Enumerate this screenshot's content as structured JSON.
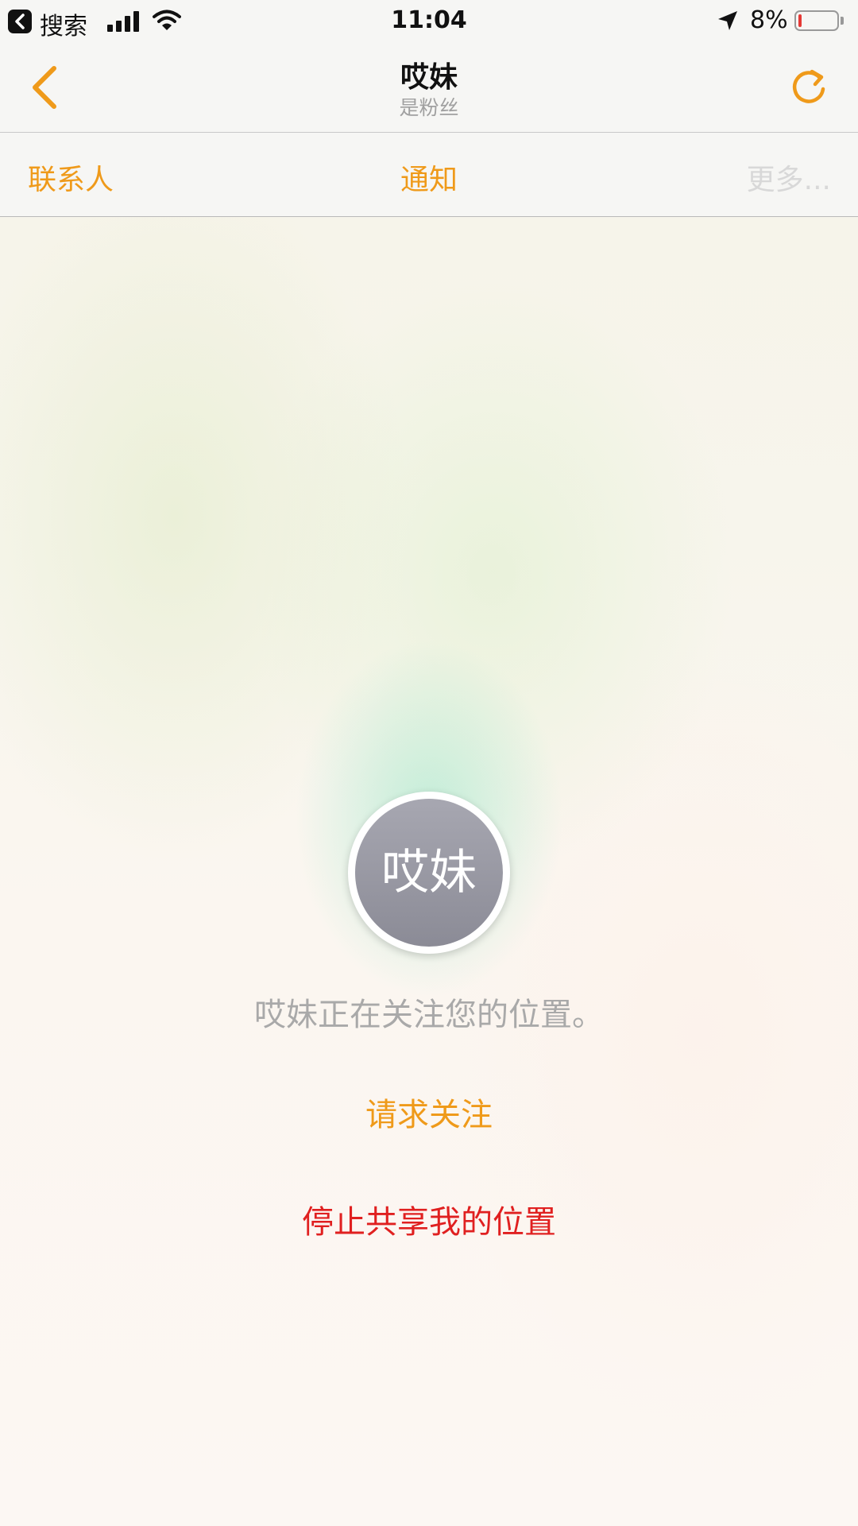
{
  "status_bar": {
    "back_app_label": "搜索",
    "time": "11:04",
    "battery_percent": "8%",
    "battery_level": 0.08,
    "icons": [
      "back-to-app-icon",
      "signal-icon",
      "wifi-icon",
      "location-arrow-icon",
      "battery-icon"
    ]
  },
  "nav": {
    "title": "哎妹",
    "subtitle": "是粉丝",
    "back_icon": "chevron-left-icon",
    "refresh_icon": "refresh-icon"
  },
  "tabs": {
    "contacts": "联系人",
    "notifications": "通知",
    "more": "更多..."
  },
  "profile": {
    "avatar_text": "哎妹",
    "status_text": "哎妹正在关注您的位置。"
  },
  "actions": {
    "request_follow": "请求关注",
    "stop_sharing": "停止共享我的位置"
  },
  "colors": {
    "accent": "#ef9a1a",
    "destructive": "#e02020",
    "secondary_text": "#a9a9a9",
    "battery_low": "#e53935"
  }
}
